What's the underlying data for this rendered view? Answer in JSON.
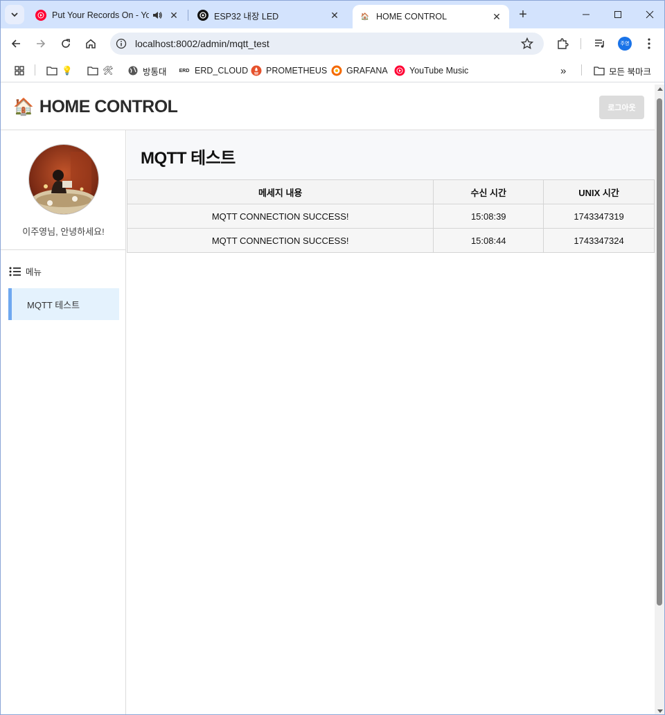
{
  "browser": {
    "tabs": [
      {
        "title": "Put Your Records On - Yo",
        "audio": true
      },
      {
        "title": "ESP32 내장 LED"
      },
      {
        "title": "HOME CONTROL",
        "active": true
      }
    ],
    "url": "localhost:8002/admin/mqtt_test",
    "profile_initials": "주영",
    "bookmarks": [
      {
        "label": "💡",
        "icon": "folder-icon"
      },
      {
        "label": "🛠",
        "icon": "folder-icon"
      },
      {
        "label": "방통대",
        "icon": "globe-icon"
      },
      {
        "label": "ERD_CLOUD",
        "icon": "erd-icon"
      },
      {
        "label": "PROMETHEUS",
        "icon": "prometheus-icon"
      },
      {
        "label": "GRAFANA",
        "icon": "grafana-icon"
      },
      {
        "label": "YouTube Music",
        "icon": "youtube-music-icon"
      }
    ],
    "all_bookmarks": "모든 북마크"
  },
  "header": {
    "brand_emoji": "🏠",
    "brand_title": "HOME CONTROL",
    "logout_label": "로그아웃"
  },
  "sidebar": {
    "greeting": "이주영님, 안녕하세요!",
    "menu_heading": "메뉴",
    "items": [
      {
        "label": "MQTT 테스트",
        "active": true
      }
    ]
  },
  "main": {
    "title": "MQTT 테스트",
    "table": {
      "columns": [
        "메세지 내용",
        "수신 시간",
        "UNIX 시간"
      ],
      "rows": [
        [
          "MQTT CONNECTION SUCCESS!",
          "15:08:39",
          "1743347319"
        ],
        [
          "MQTT CONNECTION SUCCESS!",
          "15:08:44",
          "1743347324"
        ]
      ]
    }
  },
  "colors": {
    "tabbar": "#d3e3fd",
    "active_menu_bg": "#e4f2fd",
    "active_menu_border": "#6fa8f0",
    "logout_bg": "#dcdcdc"
  }
}
